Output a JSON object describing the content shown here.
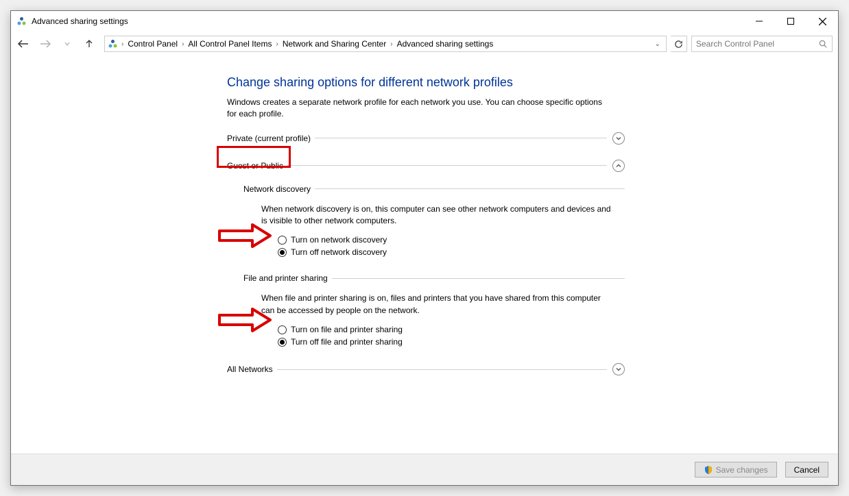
{
  "window": {
    "title": "Advanced sharing settings"
  },
  "breadcrumbs": {
    "a": "Control Panel",
    "b": "All Control Panel Items",
    "c": "Network and Sharing Center",
    "d": "Advanced sharing settings"
  },
  "search": {
    "placeholder": "Search Control Panel"
  },
  "page": {
    "title": "Change sharing options for different network profiles",
    "desc": "Windows creates a separate network profile for each network you use. You can choose specific options for each profile."
  },
  "sections": {
    "private": "Private (current profile)",
    "guest": "Guest or Public",
    "all": "All Networks"
  },
  "netdisc": {
    "head": "Network discovery",
    "desc": "When network discovery is on, this computer can see other network computers and devices and is visible to other network computers.",
    "on": "Turn on network discovery",
    "off": "Turn off network discovery"
  },
  "fps": {
    "head": "File and printer sharing",
    "desc": "When file and printer sharing is on, files and printers that you have shared from this computer can be accessed by people on the network.",
    "on": "Turn on file and printer sharing",
    "off": "Turn off file and printer sharing"
  },
  "buttons": {
    "save": "Save changes",
    "cancel": "Cancel"
  }
}
